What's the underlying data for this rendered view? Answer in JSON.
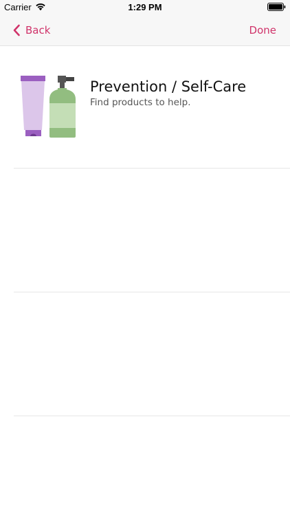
{
  "status_bar": {
    "carrier": "Carrier",
    "time": "1:29 PM",
    "icons": [
      "wifi-icon",
      "battery-icon"
    ]
  },
  "nav": {
    "back_label": "Back",
    "done_label": "Done",
    "tint_color": "#d0336a",
    "icons": [
      "chevron-left-icon"
    ]
  },
  "header": {
    "title": "Prevention / Self-Care",
    "subtitle": "Find products to help.",
    "illustration": "skincare-products-icon"
  },
  "list": {
    "cells": [
      {
        "name": "empty-cell-1"
      },
      {
        "name": "empty-cell-2"
      }
    ]
  }
}
